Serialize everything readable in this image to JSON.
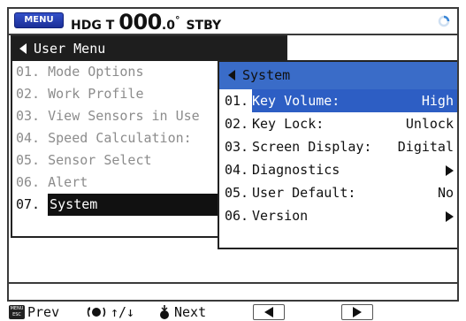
{
  "header": {
    "menu_key": "MENU",
    "heading_label": "HDG T",
    "heading_int": "000",
    "heading_dec": ".0",
    "heading_unit": "°",
    "mode": "STBY",
    "status_icon": "busy-ring-icon",
    "status_color": "#3a86d6"
  },
  "main_menu": {
    "title": "User Menu",
    "items": [
      {
        "num": "01.",
        "label": "Mode Options"
      },
      {
        "num": "02.",
        "label": "Work Profile"
      },
      {
        "num": "03.",
        "label": "View Sensors in Use"
      },
      {
        "num": "04.",
        "label": "Speed Calculation:"
      },
      {
        "num": "05.",
        "label": "Sensor Select"
      },
      {
        "num": "06.",
        "label": "Alert"
      },
      {
        "num": "07.",
        "label": "System"
      }
    ],
    "selected_index": 6
  },
  "sub_menu": {
    "title": "System",
    "items": [
      {
        "num": "01.",
        "label": "Key Volume:",
        "value": "High"
      },
      {
        "num": "02.",
        "label": "Key Lock:",
        "value": "Unlock"
      },
      {
        "num": "03.",
        "label": "Screen Display:",
        "value": "Digital"
      },
      {
        "num": "04.",
        "label": "Diagnostics",
        "value": ""
      },
      {
        "num": "05.",
        "label": "User Default:",
        "value": "No"
      },
      {
        "num": "06.",
        "label": "Version",
        "value": ""
      }
    ],
    "selected_index": 0,
    "highlight_color": "#2d5ec4",
    "title_color": "#3a6cc8"
  },
  "footer": {
    "prev_label": "Prev",
    "prev_key_icon": "menu-esc-key-icon",
    "knob_label": "↑/↓",
    "knob_icon": "rotary-knob-icon",
    "next_label": "Next",
    "next_icon": "push-knob-icon",
    "page_left_icon": "page-left-icon",
    "page_right_icon": "page-right-icon"
  }
}
